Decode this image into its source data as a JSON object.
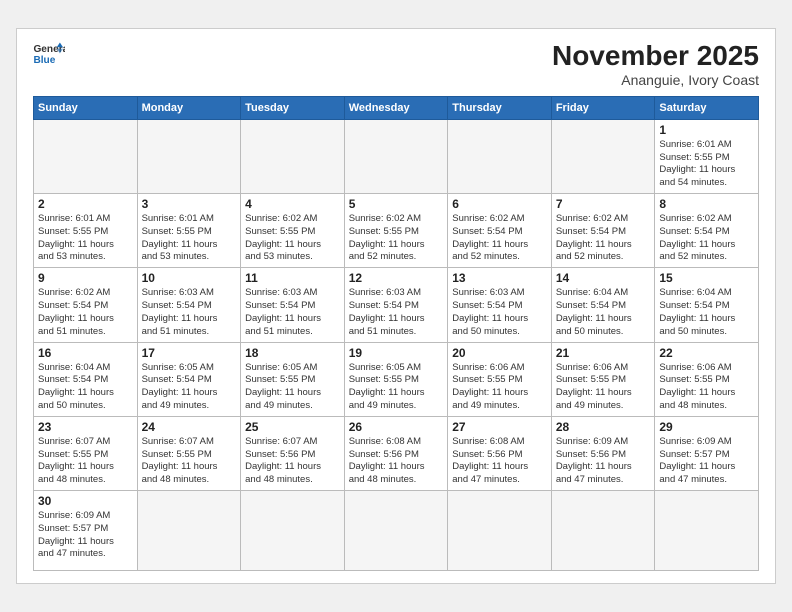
{
  "header": {
    "logo_line1": "General",
    "logo_line2": "Blue",
    "month_title": "November 2025",
    "location": "Ananguie, Ivory Coast"
  },
  "weekdays": [
    "Sunday",
    "Monday",
    "Tuesday",
    "Wednesday",
    "Thursday",
    "Friday",
    "Saturday"
  ],
  "weeks": [
    [
      {
        "day": "",
        "info": ""
      },
      {
        "day": "",
        "info": ""
      },
      {
        "day": "",
        "info": ""
      },
      {
        "day": "",
        "info": ""
      },
      {
        "day": "",
        "info": ""
      },
      {
        "day": "",
        "info": ""
      },
      {
        "day": "1",
        "info": "Sunrise: 6:01 AM\nSunset: 5:55 PM\nDaylight: 11 hours\nand 54 minutes."
      }
    ],
    [
      {
        "day": "2",
        "info": "Sunrise: 6:01 AM\nSunset: 5:55 PM\nDaylight: 11 hours\nand 53 minutes."
      },
      {
        "day": "3",
        "info": "Sunrise: 6:01 AM\nSunset: 5:55 PM\nDaylight: 11 hours\nand 53 minutes."
      },
      {
        "day": "4",
        "info": "Sunrise: 6:02 AM\nSunset: 5:55 PM\nDaylight: 11 hours\nand 53 minutes."
      },
      {
        "day": "5",
        "info": "Sunrise: 6:02 AM\nSunset: 5:55 PM\nDaylight: 11 hours\nand 52 minutes."
      },
      {
        "day": "6",
        "info": "Sunrise: 6:02 AM\nSunset: 5:54 PM\nDaylight: 11 hours\nand 52 minutes."
      },
      {
        "day": "7",
        "info": "Sunrise: 6:02 AM\nSunset: 5:54 PM\nDaylight: 11 hours\nand 52 minutes."
      },
      {
        "day": "8",
        "info": "Sunrise: 6:02 AM\nSunset: 5:54 PM\nDaylight: 11 hours\nand 52 minutes."
      }
    ],
    [
      {
        "day": "9",
        "info": "Sunrise: 6:02 AM\nSunset: 5:54 PM\nDaylight: 11 hours\nand 51 minutes."
      },
      {
        "day": "10",
        "info": "Sunrise: 6:03 AM\nSunset: 5:54 PM\nDaylight: 11 hours\nand 51 minutes."
      },
      {
        "day": "11",
        "info": "Sunrise: 6:03 AM\nSunset: 5:54 PM\nDaylight: 11 hours\nand 51 minutes."
      },
      {
        "day": "12",
        "info": "Sunrise: 6:03 AM\nSunset: 5:54 PM\nDaylight: 11 hours\nand 51 minutes."
      },
      {
        "day": "13",
        "info": "Sunrise: 6:03 AM\nSunset: 5:54 PM\nDaylight: 11 hours\nand 50 minutes."
      },
      {
        "day": "14",
        "info": "Sunrise: 6:04 AM\nSunset: 5:54 PM\nDaylight: 11 hours\nand 50 minutes."
      },
      {
        "day": "15",
        "info": "Sunrise: 6:04 AM\nSunset: 5:54 PM\nDaylight: 11 hours\nand 50 minutes."
      }
    ],
    [
      {
        "day": "16",
        "info": "Sunrise: 6:04 AM\nSunset: 5:54 PM\nDaylight: 11 hours\nand 50 minutes."
      },
      {
        "day": "17",
        "info": "Sunrise: 6:05 AM\nSunset: 5:54 PM\nDaylight: 11 hours\nand 49 minutes."
      },
      {
        "day": "18",
        "info": "Sunrise: 6:05 AM\nSunset: 5:55 PM\nDaylight: 11 hours\nand 49 minutes."
      },
      {
        "day": "19",
        "info": "Sunrise: 6:05 AM\nSunset: 5:55 PM\nDaylight: 11 hours\nand 49 minutes."
      },
      {
        "day": "20",
        "info": "Sunrise: 6:06 AM\nSunset: 5:55 PM\nDaylight: 11 hours\nand 49 minutes."
      },
      {
        "day": "21",
        "info": "Sunrise: 6:06 AM\nSunset: 5:55 PM\nDaylight: 11 hours\nand 49 minutes."
      },
      {
        "day": "22",
        "info": "Sunrise: 6:06 AM\nSunset: 5:55 PM\nDaylight: 11 hours\nand 48 minutes."
      }
    ],
    [
      {
        "day": "23",
        "info": "Sunrise: 6:07 AM\nSunset: 5:55 PM\nDaylight: 11 hours\nand 48 minutes."
      },
      {
        "day": "24",
        "info": "Sunrise: 6:07 AM\nSunset: 5:55 PM\nDaylight: 11 hours\nand 48 minutes."
      },
      {
        "day": "25",
        "info": "Sunrise: 6:07 AM\nSunset: 5:56 PM\nDaylight: 11 hours\nand 48 minutes."
      },
      {
        "day": "26",
        "info": "Sunrise: 6:08 AM\nSunset: 5:56 PM\nDaylight: 11 hours\nand 48 minutes."
      },
      {
        "day": "27",
        "info": "Sunrise: 6:08 AM\nSunset: 5:56 PM\nDaylight: 11 hours\nand 47 minutes."
      },
      {
        "day": "28",
        "info": "Sunrise: 6:09 AM\nSunset: 5:56 PM\nDaylight: 11 hours\nand 47 minutes."
      },
      {
        "day": "29",
        "info": "Sunrise: 6:09 AM\nSunset: 5:57 PM\nDaylight: 11 hours\nand 47 minutes."
      }
    ],
    [
      {
        "day": "30",
        "info": "Sunrise: 6:09 AM\nSunset: 5:57 PM\nDaylight: 11 hours\nand 47 minutes."
      },
      {
        "day": "",
        "info": ""
      },
      {
        "day": "",
        "info": ""
      },
      {
        "day": "",
        "info": ""
      },
      {
        "day": "",
        "info": ""
      },
      {
        "day": "",
        "info": ""
      },
      {
        "day": "",
        "info": ""
      }
    ]
  ]
}
